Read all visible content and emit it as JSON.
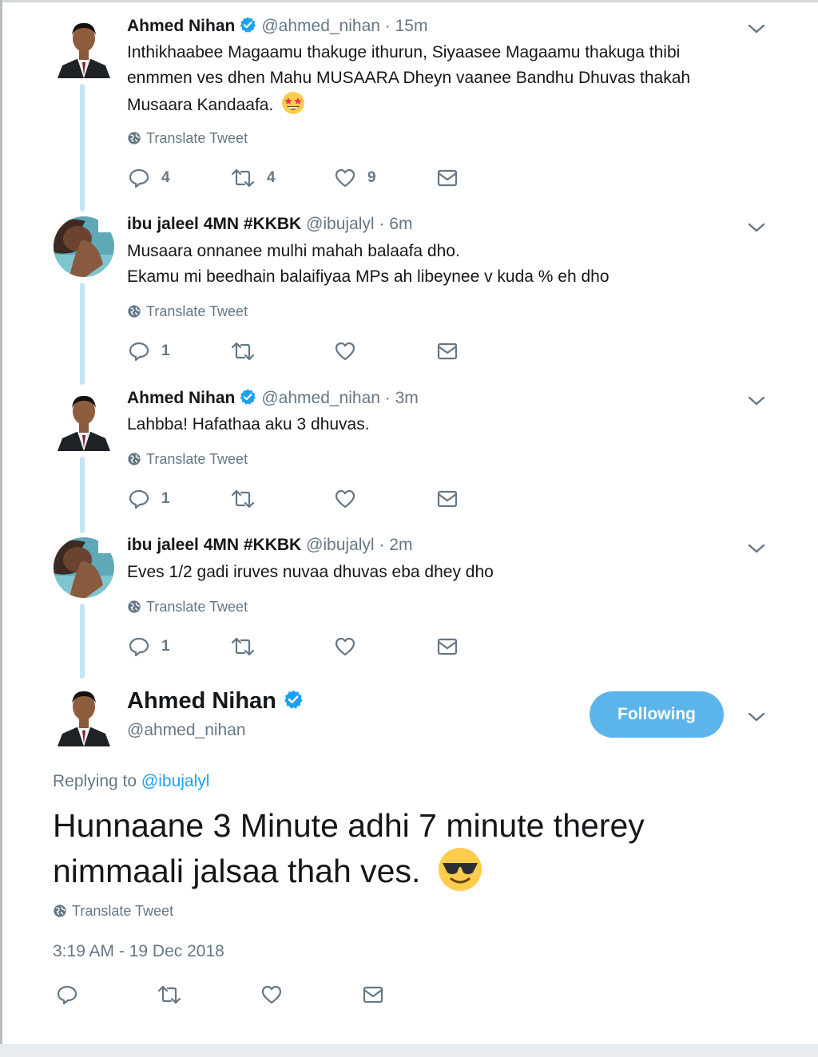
{
  "thread": [
    {
      "name": "Ahmed Nihan",
      "handle": "@ahmed_nihan",
      "dot": "·",
      "time": "15m",
      "verified": true,
      "text": "Inthikhaabee Magaamu thakuge ithurun, Siyaasee Magaamu thakuga thibi enmmen ves dhen Mahu MUSAARA Dheyn vaanee Bandhu Dhuvas thakah Musaara Kandaafa.",
      "emoji": "star-struck",
      "translate": "Translate Tweet",
      "replies": "4",
      "retweets": "4",
      "likes": "9"
    },
    {
      "name": "ibu jaleel 4MN #KKBK",
      "handle": "@ibujalyl",
      "dot": "·",
      "time": "6m",
      "verified": false,
      "text_line1": "Musaara onnanee mulhi mahah balaafa dho.",
      "text_line2": "Ekamu mi beedhain balaifiyaa MPs ah libeynee v kuda % eh dho",
      "translate": "Translate Tweet",
      "replies": "1"
    },
    {
      "name": "Ahmed Nihan",
      "handle": "@ahmed_nihan",
      "dot": "·",
      "time": "3m",
      "verified": true,
      "text": "Lahbba! Hafathaa aku 3 dhuvas.",
      "translate": "Translate Tweet",
      "replies": "1"
    },
    {
      "name": "ibu jaleel 4MN #KKBK",
      "handle": "@ibujalyl",
      "dot": "·",
      "time": "2m",
      "verified": false,
      "text": "Eves 1/2 gadi iruves nuvaa dhuvas eba dhey dho",
      "translate": "Translate Tweet",
      "replies": "1"
    }
  ],
  "main_tweet": {
    "name": "Ahmed Nihan",
    "handle": "@ahmed_nihan",
    "verified": true,
    "follow_label": "Following",
    "replying_prefix": "Replying to",
    "replying_handle": "@ibujalyl",
    "text": "Hunnaane 3 Minute adhi 7 minute therey nimmaali jalsaa thah ves.",
    "emoji": "sunglasses-face",
    "translate": "Translate Tweet",
    "timestamp": "3:19 AM - 19 Dec 2018"
  },
  "colors": {
    "accent": "#1da1f2",
    "follow_button": "#5bb5ea",
    "muted": "#657786",
    "thread_line": "#c4e5f7",
    "text": "#14171a"
  }
}
